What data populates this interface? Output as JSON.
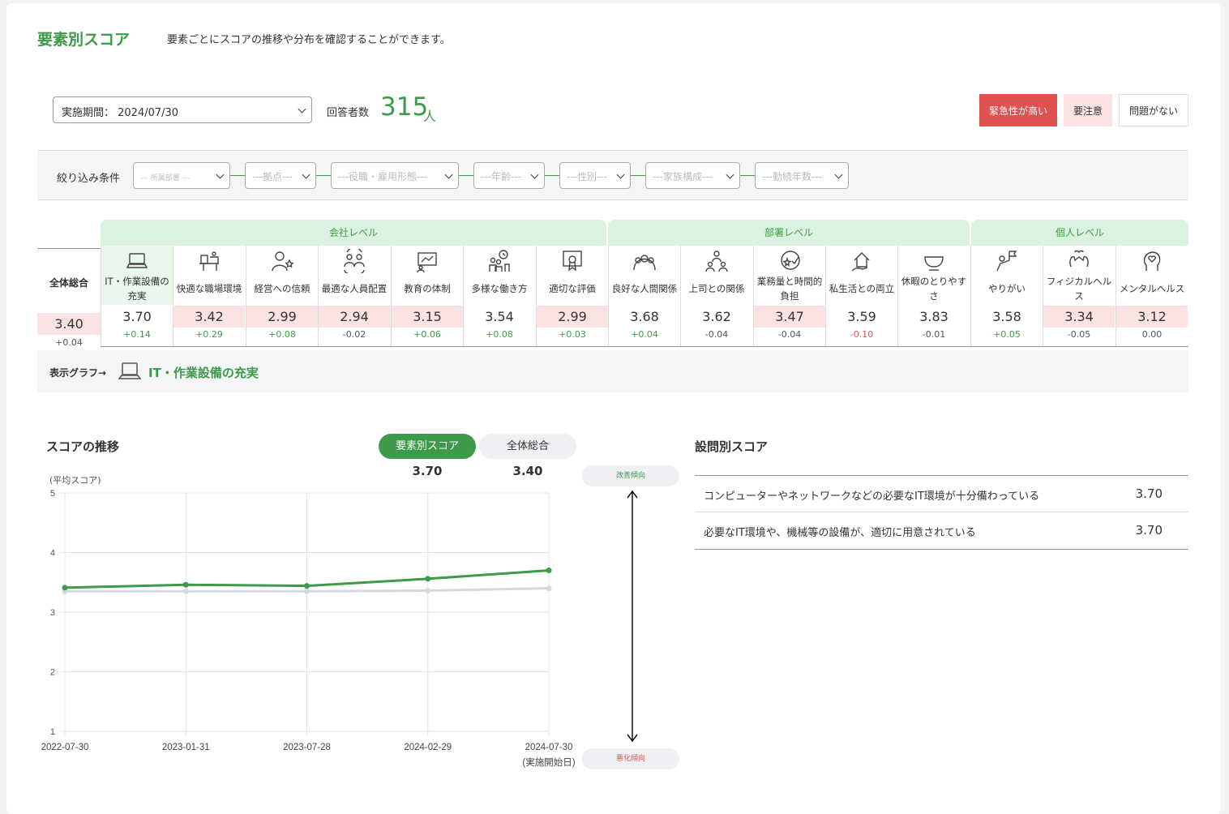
{
  "header": {
    "title": "要素別スコア",
    "description": "要素ごとにスコアの推移や分布を確認することができます。"
  },
  "period": {
    "value": "実施期間： 2024/07/30"
  },
  "respondents": {
    "label": "回答者数",
    "count": "315",
    "unit": "人"
  },
  "legend": {
    "urgent": "緊急性が高い",
    "caution": "要注意",
    "ok": "問題がない"
  },
  "filters": {
    "label": "絞り込み条件",
    "selects": [
      "--- 所属部署 ---",
      "---拠点---",
      "---役職・雇用形態---",
      "---年齢---",
      "---性別---",
      "---家族構成---",
      "---勤続年数---"
    ]
  },
  "groups": {
    "company": "会社レベル",
    "department": "部署レベル",
    "individual": "個人レベル"
  },
  "overall": {
    "name": "全体総合",
    "score": "3.40",
    "delta": "+0.04"
  },
  "elements": [
    {
      "name": "IT・作業設備の充実",
      "score": "3.70",
      "delta": "+0.14",
      "icon": "laptop-icon"
    },
    {
      "name": "快適な職場環境",
      "score": "3.42",
      "delta": "+0.29",
      "icon": "office-desk-icon"
    },
    {
      "name": "経営への信頼",
      "score": "2.99",
      "delta": "+0.08",
      "icon": "person-star-icon"
    },
    {
      "name": "最適な人員配置",
      "score": "2.94",
      "delta": "-0.02",
      "icon": "people-rotate-icon"
    },
    {
      "name": "教育の体制",
      "score": "3.15",
      "delta": "+0.06",
      "icon": "whiteboard-icon"
    },
    {
      "name": "多様な働き方",
      "score": "3.54",
      "delta": "+0.08",
      "icon": "people-clock-icon"
    },
    {
      "name": "適切な評価",
      "score": "2.99",
      "delta": "+0.03",
      "icon": "certificate-icon"
    },
    {
      "name": "良好な人間関係",
      "score": "3.68",
      "delta": "+0.04",
      "icon": "group-icon"
    },
    {
      "name": "上司との関係",
      "score": "3.62",
      "delta": "-0.04",
      "icon": "hierarchy-icon"
    },
    {
      "name": "業務量と時間的負担",
      "score": "3.47",
      "delta": "-0.04",
      "icon": "clock-star-icon"
    },
    {
      "name": "私生活との両立",
      "score": "3.59",
      "delta": "-0.10",
      "icon": "home-hand-icon"
    },
    {
      "name": "休暇のとりやすさ",
      "score": "3.83",
      "delta": "-0.01",
      "icon": "cup-icon"
    },
    {
      "name": "やりがい",
      "score": "3.58",
      "delta": "+0.05",
      "icon": "flag-person-icon"
    },
    {
      "name": "フィジカルヘルス",
      "score": "3.34",
      "delta": "-0.05",
      "icon": "muscle-icon"
    },
    {
      "name": "メンタルヘルス",
      "score": "3.12",
      "delta": "0.00",
      "icon": "head-heart-icon"
    }
  ],
  "graph": {
    "label": "表示グラフ→",
    "selected": "IT・作業設備の充実"
  },
  "trend": {
    "title": "スコアの推移",
    "tab_element": "要素別スコア",
    "tab_overall": "全体総合",
    "val_element": "3.70",
    "val_overall": "3.40",
    "y_unit": "(平均スコア)",
    "improve": "改善傾向",
    "worsen": "悪化傾向",
    "start_note": "(実施開始日)"
  },
  "questions": {
    "title": "設問別スコア",
    "rows": [
      {
        "text": "コンピューターやネットワークなどの必要なIT環境が十分備わっている",
        "score": "3.70"
      },
      {
        "text": "必要なIT環境や、機械等の設備が、適切に用意されている",
        "score": "3.70"
      }
    ]
  },
  "colors": {
    "accent": "#3d9a49",
    "urgent": "#e05252",
    "caution": "#fbe3e3",
    "overall_line": "#d3d9de"
  },
  "chart_data": {
    "type": "line",
    "x": [
      "2022-07-30",
      "2023-01-31",
      "2023-07-28",
      "2024-02-29",
      "2024-07-30"
    ],
    "series": [
      {
        "name": "要素別スコア",
        "values": [
          3.41,
          3.46,
          3.44,
          3.56,
          3.7
        ]
      },
      {
        "name": "全体総合",
        "values": [
          3.35,
          3.35,
          3.35,
          3.36,
          3.4
        ]
      }
    ],
    "ylim": [
      1,
      5
    ],
    "yticks": [
      "1",
      "2",
      "3",
      "4",
      "5"
    ],
    "grid": true
  }
}
